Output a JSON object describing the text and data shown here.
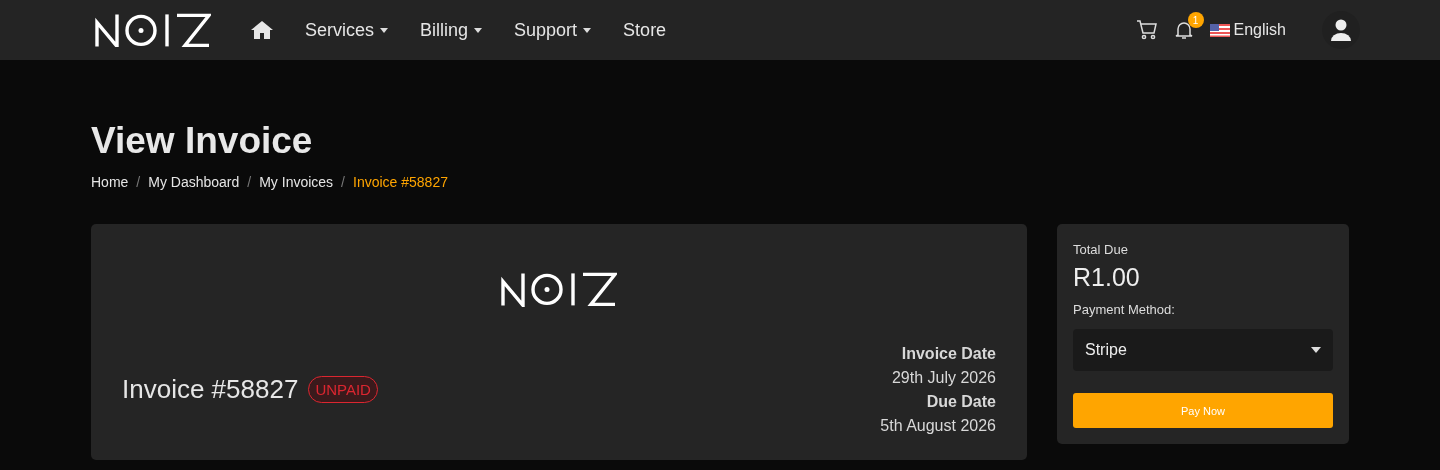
{
  "nav": {
    "items": [
      {
        "kind": "home"
      },
      {
        "kind": "dropdown",
        "label": "Services"
      },
      {
        "kind": "dropdown",
        "label": "Billing"
      },
      {
        "kind": "dropdown",
        "label": "Support"
      },
      {
        "kind": "link",
        "label": "Store"
      }
    ],
    "notifications": "1",
    "language": "English"
  },
  "page": {
    "title": "View Invoice",
    "separator": "/",
    "breadcrumb": [
      {
        "label": "Home",
        "selected": false
      },
      {
        "label": "My Dashboard",
        "selected": false
      },
      {
        "label": "My Invoices",
        "selected": false
      },
      {
        "label": "Invoice #58827",
        "selected": true
      }
    ]
  },
  "invoice": {
    "number": "Invoice #58827",
    "status": "UNPAID",
    "details": [
      {
        "label": "Invoice Date",
        "value": "29th July 2026"
      },
      {
        "label": "Due Date",
        "value": "5th August 2026"
      }
    ]
  },
  "payment": {
    "total_label": "Total Due",
    "total": "R1.00",
    "method_label": "Payment Method:",
    "method": "Stripe",
    "button": "Pay Now"
  }
}
